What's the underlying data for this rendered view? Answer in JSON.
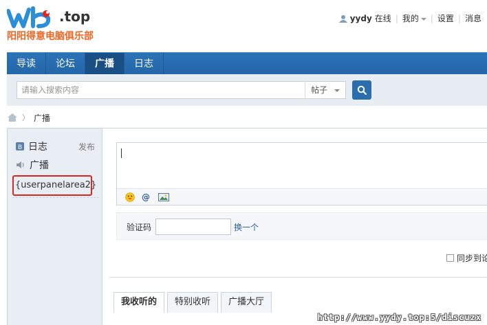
{
  "header": {
    "logo_tld": ".top",
    "logo_subtitle": "阳阳得意电脑俱乐部",
    "user": {
      "name": "yydy",
      "status": "在线"
    },
    "links": [
      "我的",
      "设置",
      "消息"
    ]
  },
  "nav": {
    "tabs": [
      {
        "label": "导读",
        "active": false
      },
      {
        "label": "论坛",
        "active": false
      },
      {
        "label": "广播",
        "active": true
      },
      {
        "label": "日志",
        "active": false
      }
    ]
  },
  "search": {
    "placeholder": "请输入搜索内容",
    "type": "帖子"
  },
  "breadcrumb": {
    "current": "广播"
  },
  "sidebar": {
    "items": [
      {
        "label": "日志",
        "icon": "blog-icon"
      },
      {
        "label": "广播",
        "icon": "speaker-icon"
      }
    ],
    "publish": "发布",
    "placeholder_var": "{userpanelarea2}"
  },
  "compose": {
    "captcha_label": "验证码",
    "captcha_change": "换一个",
    "sync_label": "同步到论"
  },
  "feed_tabs": [
    {
      "label": "我收听的",
      "active": true
    },
    {
      "label": "特别收听",
      "active": false
    },
    {
      "label": "广播大厅",
      "active": false
    }
  ],
  "watermark": "http://www.yydy.top:5/discuzx",
  "colors": {
    "nav_blue": "#2c73b8",
    "logo_blue": "#2a8fd8",
    "logo_orange": "#f26522",
    "highlight_red": "#e0261e"
  }
}
